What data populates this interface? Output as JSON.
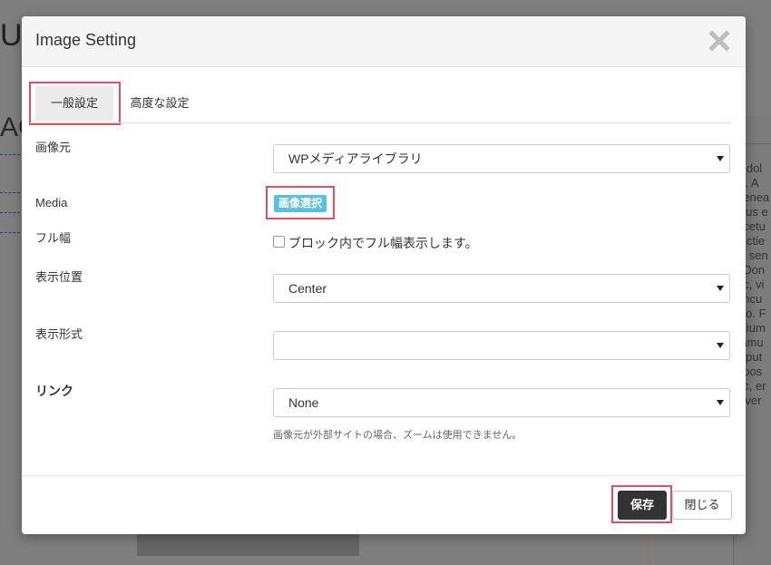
{
  "background": {
    "heading_fragment": "U",
    "subheading_fragment": "AG",
    "side_text_lines": [
      "n dol",
      "lit. A",
      "nenea",
      "ibus e",
      "ecetu",
      "trictie",
      "s, sen",
      ". Don",
      "ec, vi",
      "oncu",
      "sto. F",
      "etium",
      "ramu",
      "ulput",
      ", pos",
      "ac, er",
      "viver"
    ]
  },
  "modal": {
    "title": "Image Setting",
    "close_icon": "close-x-icon",
    "tabs": [
      {
        "label": "一般設定",
        "active": true
      },
      {
        "label": "高度な設定",
        "active": false
      }
    ],
    "fields": {
      "source": {
        "label": "画像元",
        "value": "WPメディアライブラリ"
      },
      "media": {
        "label": "Media",
        "button_label": "画像選択"
      },
      "full_width": {
        "label": "フル幅",
        "checkbox_label": "ブロック内でフル幅表示します。",
        "checked": false
      },
      "position": {
        "label": "表示位置",
        "value": "Center"
      },
      "style": {
        "label": "表示形式",
        "value": ""
      },
      "link": {
        "label": "リンク",
        "value": "None"
      }
    },
    "help_text": "画像元が外部サイトの場合、ズームは使用できません。",
    "buttons": {
      "save": "保存",
      "close": "閉じる"
    }
  },
  "colors": {
    "highlight": "#e0505e",
    "media_button": "#5bc0de",
    "save_button": "#333333"
  }
}
